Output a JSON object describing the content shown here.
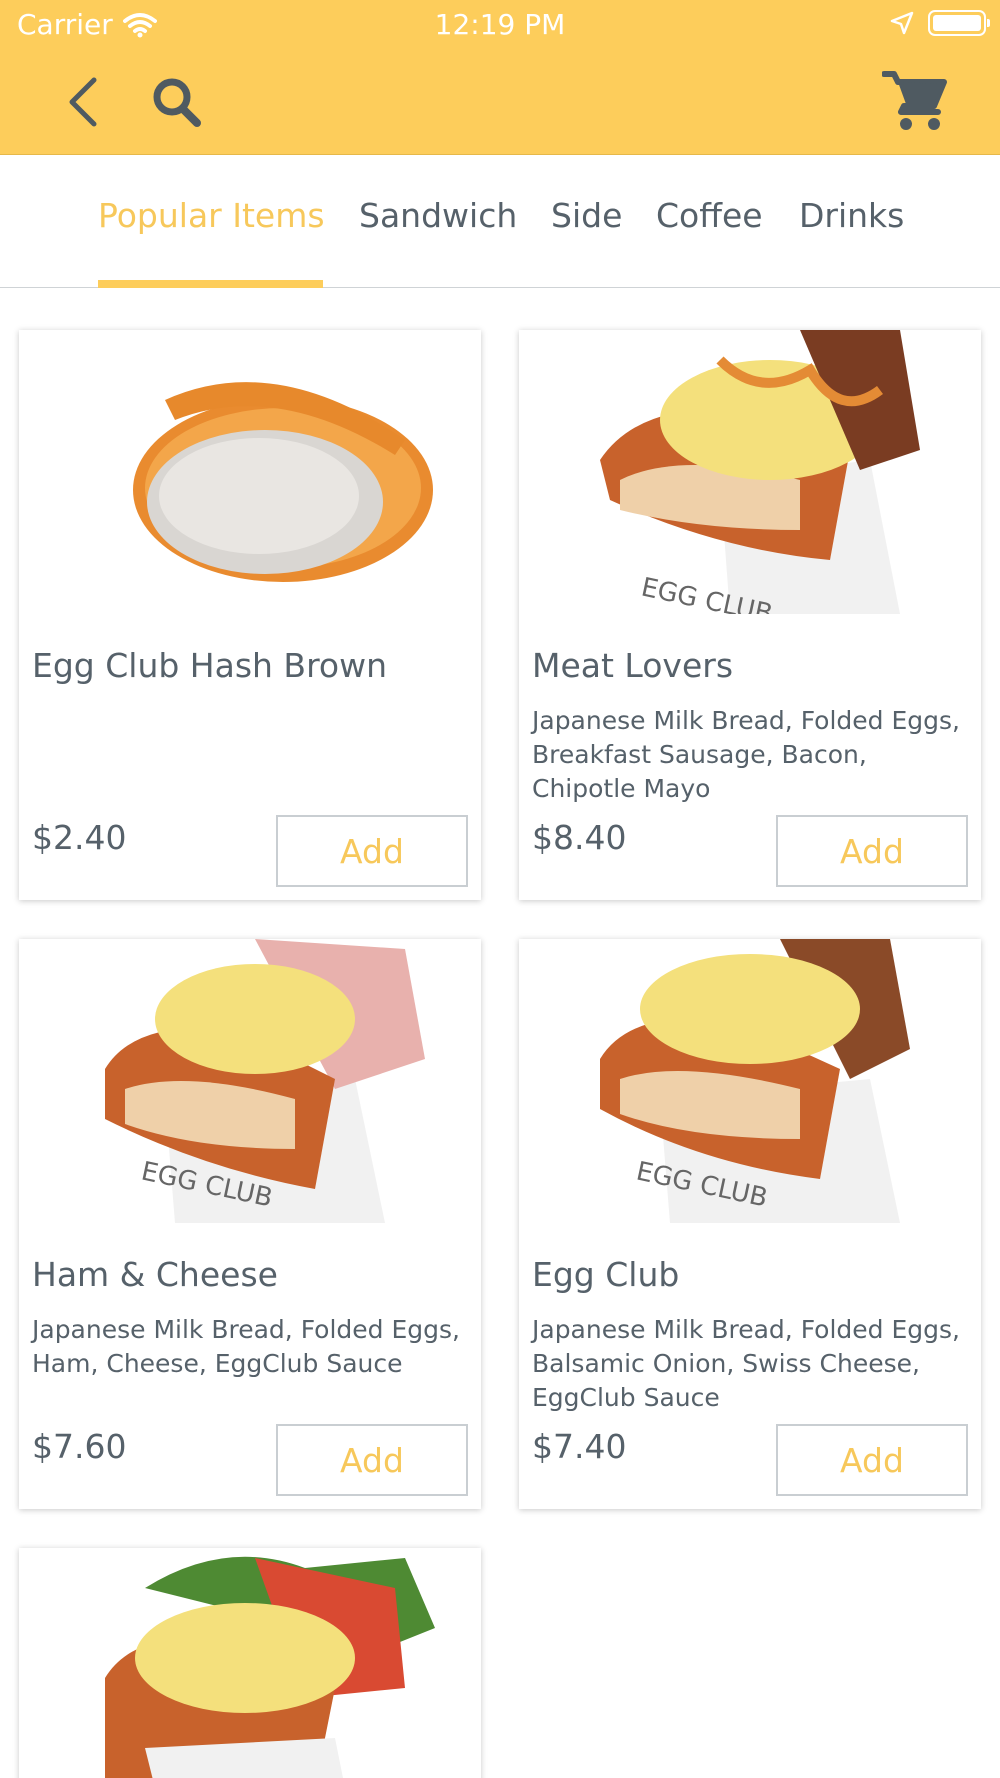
{
  "status_bar": {
    "carrier": "Carrier",
    "time": "12:19 PM"
  },
  "tabs": [
    {
      "label": "Popular Items",
      "active": true
    },
    {
      "label": "Sandwich",
      "active": false
    },
    {
      "label": "Side",
      "active": false
    },
    {
      "label": "Coffee",
      "active": false
    },
    {
      "label": "Drinks",
      "active": false
    }
  ],
  "products": [
    {
      "name": "Egg Club Hash Brown",
      "description": "",
      "price": "$2.40",
      "add_label": "Add"
    },
    {
      "name": "Meat Lovers",
      "description": "Japanese Milk Bread, Folded Eggs, Breakfast Sausage, Bacon, Chipotle Mayo",
      "price": "$8.40",
      "add_label": "Add"
    },
    {
      "name": "Ham & Cheese",
      "description": "Japanese Milk Bread, Folded Eggs, Ham, Cheese, EggClub Sauce",
      "price": "$7.60",
      "add_label": "Add"
    },
    {
      "name": "Egg Club",
      "description": "Japanese Milk Bread, Folded Eggs, Balsamic Onion, Swiss Cheese, EggClub Sauce",
      "price": "$7.40",
      "add_label": "Add"
    }
  ],
  "icons": {
    "back": "chevron-left-icon",
    "search": "search-icon",
    "cart": "shopping-cart-icon",
    "wifi": "wifi-icon",
    "location": "location-arrow-icon",
    "battery": "battery-icon"
  },
  "colors": {
    "header": "#fdcd5b",
    "accent": "#f7c85b",
    "text": "#56616a",
    "icon": "#4f5a61"
  }
}
